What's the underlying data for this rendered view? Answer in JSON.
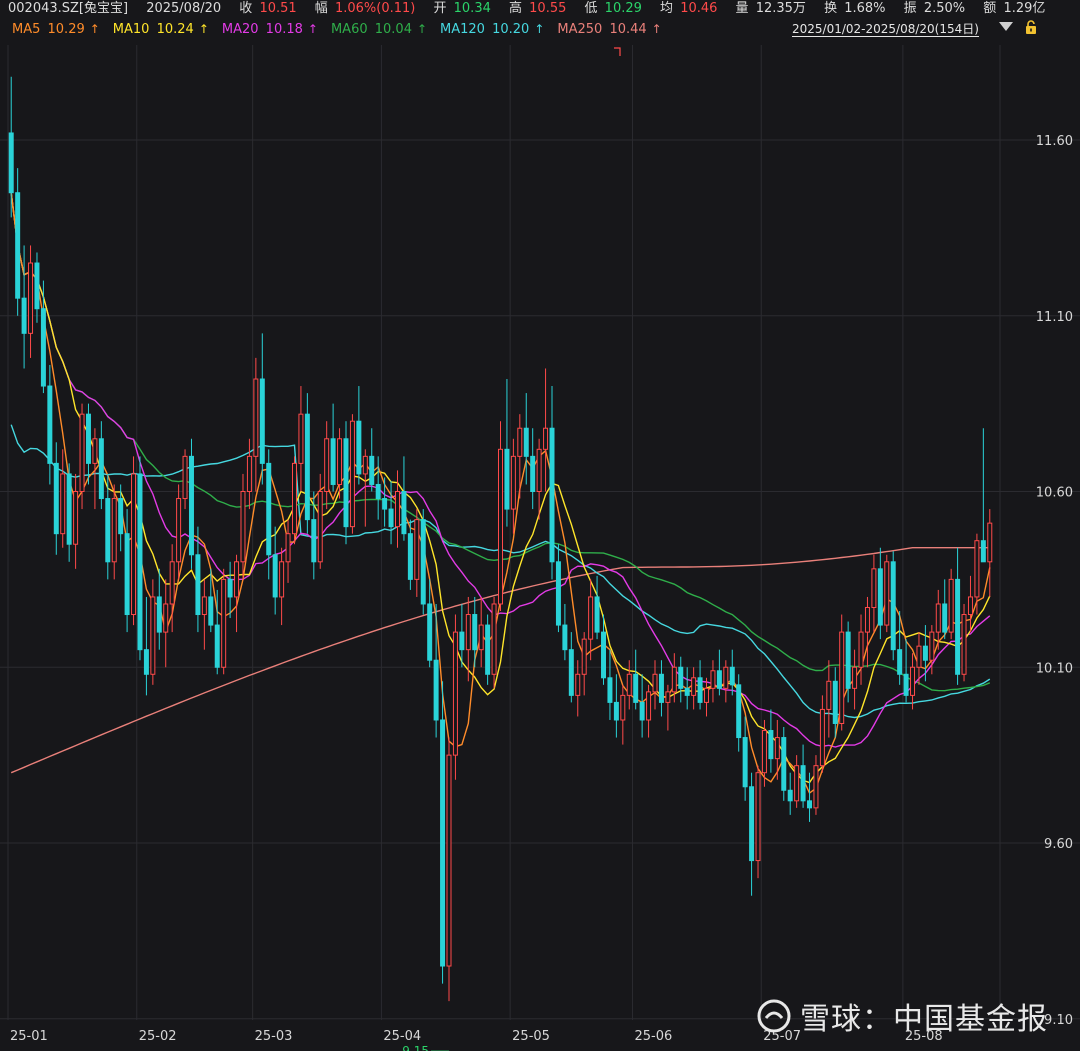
{
  "header": {
    "code": "002043.SZ[兔宝宝]",
    "date": "2025/08/20",
    "close_label": "收",
    "close": "10.51",
    "change_label": "幅",
    "change": "1.06%(0.11)",
    "open_label": "开",
    "open": "10.34",
    "high_label": "高",
    "high": "10.55",
    "low_label": "低",
    "low": "10.29",
    "avg_label": "均",
    "avg": "10.46",
    "volume_label": "量",
    "volume": "12.35万",
    "turnover_label": "换",
    "turnover": "1.68%",
    "amplitude_label": "振",
    "amplitude": "2.50%",
    "amount_label": "额",
    "amount": "1.29亿",
    "range": "2025/01/02-2025/08/20(154日)"
  },
  "ma_legend": [
    {
      "label": "MA5",
      "value": "10.29",
      "color": "#ff8c2a",
      "arrow": "↑"
    },
    {
      "label": "MA10",
      "value": "10.24",
      "color": "#ffe52a",
      "arrow": "↑"
    },
    {
      "label": "MA20",
      "value": "10.18",
      "color": "#e33be6",
      "arrow": "↑"
    },
    {
      "label": "MA60",
      "value": "10.04",
      "color": "#2fae4a",
      "arrow": "↑"
    },
    {
      "label": "MA120",
      "value": "10.20",
      "color": "#46d8e0",
      "arrow": "↑"
    },
    {
      "label": "MA250",
      "value": "10.44",
      "color": "#e9807a",
      "arrow": "↑"
    }
  ],
  "icons": {
    "dropdown": "chevron-down-icon",
    "lock": "lock-icon",
    "watermark_logo": "snowball-logo-icon"
  },
  "watermark": "雪球：中国基金报",
  "chart_data": {
    "type": "candlestick",
    "title": "",
    "ylim": [
      9.1,
      11.85
    ],
    "y_ticks": [
      "11.60",
      "11.10",
      "10.60",
      "10.10",
      "9.60",
      "9.10"
    ],
    "x_ticks": [
      "25-01",
      "25-02",
      "25-03",
      "25-04",
      "25-05",
      "25-06",
      "25-07",
      "25-08"
    ],
    "min_label": "9.15",
    "colors": {
      "up": "#ff4a4a",
      "down": "#2ad3d8"
    },
    "candles_ohlc": [
      [
        11.62,
        11.78,
        11.38,
        11.45
      ],
      [
        11.45,
        11.52,
        11.1,
        11.15
      ],
      [
        11.15,
        11.3,
        10.95,
        11.05
      ],
      [
        11.05,
        11.3,
        10.98,
        11.25
      ],
      [
        11.25,
        11.28,
        11.08,
        11.12
      ],
      [
        11.12,
        11.2,
        10.88,
        10.9
      ],
      [
        10.9,
        10.96,
        10.62,
        10.68
      ],
      [
        10.68,
        10.74,
        10.42,
        10.48
      ],
      [
        10.48,
        10.72,
        10.44,
        10.65
      ],
      [
        10.65,
        10.68,
        10.4,
        10.45
      ],
      [
        10.45,
        10.65,
        10.38,
        10.6
      ],
      [
        10.6,
        10.85,
        10.55,
        10.82
      ],
      [
        10.82,
        10.85,
        10.62,
        10.68
      ],
      [
        10.68,
        10.78,
        10.55,
        10.75
      ],
      [
        10.75,
        10.8,
        10.55,
        10.58
      ],
      [
        10.58,
        10.65,
        10.35,
        10.4
      ],
      [
        10.4,
        10.62,
        10.35,
        10.58
      ],
      [
        10.58,
        10.62,
        10.43,
        10.48
      ],
      [
        10.48,
        10.55,
        10.2,
        10.25
      ],
      [
        10.25,
        10.7,
        10.22,
        10.65
      ],
      [
        10.65,
        10.7,
        10.12,
        10.15
      ],
      [
        10.15,
        10.3,
        10.02,
        10.08
      ],
      [
        10.08,
        10.35,
        10.05,
        10.3
      ],
      [
        10.3,
        10.38,
        10.15,
        10.2
      ],
      [
        10.2,
        10.35,
        10.1,
        10.28
      ],
      [
        10.28,
        10.45,
        10.2,
        10.4
      ],
      [
        10.4,
        10.62,
        10.35,
        10.58
      ],
      [
        10.58,
        10.72,
        10.55,
        10.7
      ],
      [
        10.7,
        10.75,
        10.38,
        10.42
      ],
      [
        10.42,
        10.5,
        10.2,
        10.25
      ],
      [
        10.25,
        10.35,
        10.15,
        10.3
      ],
      [
        10.3,
        10.38,
        10.2,
        10.22
      ],
      [
        10.22,
        10.32,
        10.08,
        10.1
      ],
      [
        10.1,
        10.38,
        10.08,
        10.35
      ],
      [
        10.35,
        10.4,
        10.24,
        10.3
      ],
      [
        10.3,
        10.42,
        10.2,
        10.4
      ],
      [
        10.4,
        10.65,
        10.35,
        10.6
      ],
      [
        10.6,
        10.75,
        10.55,
        10.7
      ],
      [
        10.7,
        10.98,
        10.6,
        10.92
      ],
      [
        10.92,
        11.05,
        10.62,
        10.68
      ],
      [
        10.68,
        10.72,
        10.35,
        10.42
      ],
      [
        10.42,
        10.5,
        10.25,
        10.3
      ],
      [
        10.3,
        10.44,
        10.22,
        10.4
      ],
      [
        10.4,
        10.52,
        10.34,
        10.48
      ],
      [
        10.48,
        10.7,
        10.45,
        10.68
      ],
      [
        10.68,
        10.9,
        10.6,
        10.82
      ],
      [
        10.82,
        10.88,
        10.48,
        10.52
      ],
      [
        10.52,
        10.6,
        10.35,
        10.4
      ],
      [
        10.4,
        10.65,
        10.38,
        10.6
      ],
      [
        10.6,
        10.8,
        10.55,
        10.75
      ],
      [
        10.75,
        10.85,
        10.6,
        10.62
      ],
      [
        10.62,
        10.78,
        10.58,
        10.75
      ],
      [
        10.75,
        10.8,
        10.45,
        10.5
      ],
      [
        10.5,
        10.82,
        10.48,
        10.8
      ],
      [
        10.8,
        10.9,
        10.62,
        10.65
      ],
      [
        10.65,
        10.72,
        10.5,
        10.7
      ],
      [
        10.7,
        10.78,
        10.6,
        10.62
      ],
      [
        10.62,
        10.7,
        10.52,
        10.58
      ],
      [
        10.58,
        10.64,
        10.5,
        10.55
      ],
      [
        10.55,
        10.63,
        10.45,
        10.5
      ],
      [
        10.5,
        10.66,
        10.44,
        10.6
      ],
      [
        10.6,
        10.7,
        10.46,
        10.48
      ],
      [
        10.48,
        10.52,
        10.32,
        10.35
      ],
      [
        10.35,
        10.55,
        10.3,
        10.52
      ],
      [
        10.52,
        10.55,
        10.25,
        10.28
      ],
      [
        10.28,
        10.35,
        10.1,
        10.12
      ],
      [
        10.12,
        10.28,
        9.9,
        9.95
      ],
      [
        9.95,
        10.06,
        9.2,
        9.25
      ],
      [
        9.25,
        9.9,
        9.15,
        9.85
      ],
      [
        9.85,
        10.25,
        9.78,
        10.2
      ],
      [
        10.2,
        10.28,
        10.1,
        10.15
      ],
      [
        10.15,
        10.3,
        10.06,
        10.25
      ],
      [
        10.25,
        10.3,
        10.1,
        10.15
      ],
      [
        10.15,
        10.3,
        10.1,
        10.22
      ],
      [
        10.22,
        10.25,
        10.05,
        10.08
      ],
      [
        10.08,
        10.3,
        10.04,
        10.28
      ],
      [
        10.28,
        10.8,
        10.26,
        10.72
      ],
      [
        10.72,
        10.92,
        10.5,
        10.55
      ],
      [
        10.55,
        10.75,
        10.48,
        10.7
      ],
      [
        10.7,
        10.82,
        10.58,
        10.78
      ],
      [
        10.78,
        10.88,
        10.62,
        10.7
      ],
      [
        10.7,
        10.78,
        10.55,
        10.6
      ],
      [
        10.6,
        10.75,
        10.52,
        10.72
      ],
      [
        10.72,
        10.95,
        10.6,
        10.78
      ],
      [
        10.78,
        10.9,
        10.35,
        10.4
      ],
      [
        10.4,
        10.45,
        10.2,
        10.22
      ],
      [
        10.22,
        10.28,
        10.12,
        10.15
      ],
      [
        10.15,
        10.2,
        10.0,
        10.02
      ],
      [
        10.02,
        10.12,
        9.96,
        10.08
      ],
      [
        10.08,
        10.2,
        10.02,
        10.18
      ],
      [
        10.18,
        10.35,
        10.12,
        10.3
      ],
      [
        10.3,
        10.36,
        10.18,
        10.2
      ],
      [
        10.2,
        10.25,
        10.05,
        10.07
      ],
      [
        10.07,
        10.15,
        9.95,
        10.0
      ],
      [
        10.0,
        10.08,
        9.9,
        9.95
      ],
      [
        9.95,
        10.05,
        9.88,
        10.02
      ],
      [
        10.02,
        10.12,
        9.98,
        10.08
      ],
      [
        10.08,
        10.15,
        9.98,
        10.0
      ],
      [
        10.0,
        10.08,
        9.9,
        9.95
      ],
      [
        9.95,
        10.05,
        9.9,
        10.03
      ],
      [
        10.03,
        10.12,
        9.98,
        10.08
      ],
      [
        10.08,
        10.12,
        9.96,
        10.0
      ],
      [
        10.0,
        10.05,
        9.92,
        10.03
      ],
      [
        10.03,
        10.14,
        10.0,
        10.1
      ],
      [
        10.1,
        10.13,
        10.0,
        10.04
      ],
      [
        10.04,
        10.1,
        9.98,
        10.02
      ],
      [
        10.02,
        10.1,
        9.98,
        10.07
      ],
      [
        10.07,
        10.12,
        9.98,
        10.0
      ],
      [
        10.0,
        10.07,
        9.96,
        10.04
      ],
      [
        10.04,
        10.12,
        10.0,
        10.09
      ],
      [
        10.09,
        10.15,
        10.02,
        10.04
      ],
      [
        10.04,
        10.12,
        10.0,
        10.1
      ],
      [
        10.1,
        10.15,
        10.02,
        10.05
      ],
      [
        10.05,
        10.08,
        9.86,
        9.9
      ],
      [
        9.9,
        9.96,
        9.72,
        9.76
      ],
      [
        9.76,
        9.8,
        9.45,
        9.55
      ],
      [
        9.55,
        9.82,
        9.5,
        9.8
      ],
      [
        9.8,
        9.95,
        9.76,
        9.92
      ],
      [
        9.92,
        9.98,
        9.8,
        9.84
      ],
      [
        9.84,
        9.95,
        9.78,
        9.9
      ],
      [
        9.9,
        9.93,
        9.72,
        9.75
      ],
      [
        9.75,
        9.8,
        9.68,
        9.72
      ],
      [
        9.72,
        9.85,
        9.7,
        9.82
      ],
      [
        9.82,
        9.88,
        9.7,
        9.72
      ],
      [
        9.72,
        9.8,
        9.66,
        9.7
      ],
      [
        9.7,
        9.85,
        9.68,
        9.82
      ],
      [
        9.82,
        10.02,
        9.8,
        9.98
      ],
      [
        9.98,
        10.12,
        9.9,
        10.06
      ],
      [
        10.06,
        10.1,
        9.9,
        9.94
      ],
      [
        9.94,
        10.25,
        9.92,
        10.2
      ],
      [
        10.2,
        10.23,
        10.0,
        10.04
      ],
      [
        10.04,
        10.15,
        9.98,
        10.1
      ],
      [
        10.1,
        10.25,
        10.05,
        10.2
      ],
      [
        10.2,
        10.3,
        10.1,
        10.27
      ],
      [
        10.27,
        10.42,
        10.2,
        10.38
      ],
      [
        10.38,
        10.44,
        10.18,
        10.22
      ],
      [
        10.22,
        10.42,
        10.2,
        10.4
      ],
      [
        10.4,
        10.43,
        10.12,
        10.15
      ],
      [
        10.15,
        10.26,
        10.05,
        10.08
      ],
      [
        10.08,
        10.18,
        10.0,
        10.02
      ],
      [
        10.02,
        10.14,
        9.98,
        10.1
      ],
      [
        10.1,
        10.2,
        10.05,
        10.16
      ],
      [
        10.16,
        10.22,
        10.06,
        10.12
      ],
      [
        10.12,
        10.22,
        10.08,
        10.2
      ],
      [
        10.2,
        10.32,
        10.15,
        10.28
      ],
      [
        10.28,
        10.35,
        10.18,
        10.2
      ],
      [
        10.2,
        10.38,
        10.18,
        10.35
      ],
      [
        10.35,
        10.44,
        10.05,
        10.08
      ],
      [
        10.08,
        10.28,
        10.06,
        10.25
      ],
      [
        10.25,
        10.36,
        10.2,
        10.3
      ],
      [
        10.3,
        10.48,
        10.25,
        10.46
      ],
      [
        10.46,
        10.78,
        10.4,
        10.4
      ],
      [
        10.4,
        10.55,
        10.3,
        10.51
      ]
    ]
  }
}
